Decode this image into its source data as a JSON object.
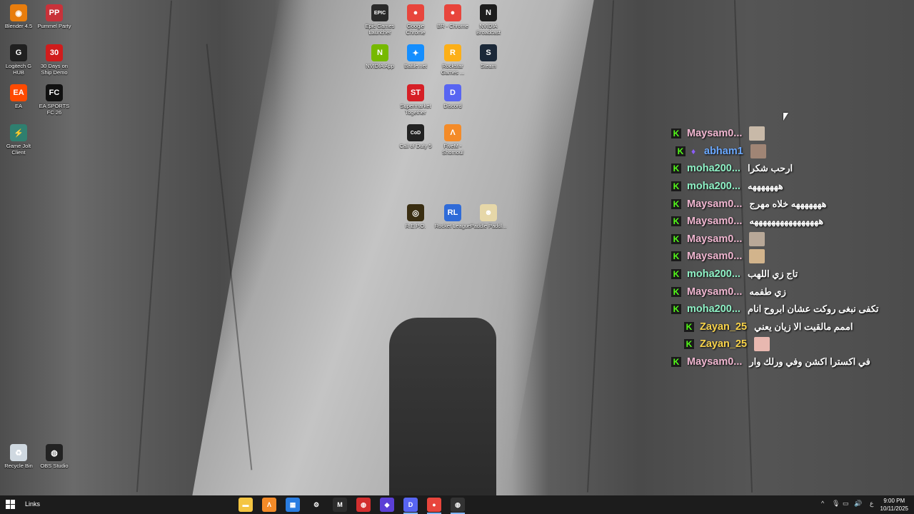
{
  "desktop_icons": [
    {
      "label": "Blender 4.5",
      "icon": "blender-icon",
      "color": "#e87d0d",
      "glyph": "◉"
    },
    {
      "label": "Pummel Party",
      "icon": "pummel-party-icon",
      "color": "#c8323a",
      "glyph": "PP"
    },
    {
      "label": "Logitech G HUB",
      "icon": "logitech-g-icon",
      "color": "#202020",
      "glyph": "G"
    },
    {
      "label": "30 Days on Ship Demo",
      "icon": "30-days-icon",
      "color": "#d01c1c",
      "glyph": "30"
    },
    {
      "label": "EA",
      "icon": "ea-icon",
      "color": "#ff4a00",
      "glyph": "EA"
    },
    {
      "label": "EA SPORTS FC 26",
      "icon": "fc26-icon",
      "color": "#111111",
      "glyph": "FC"
    },
    {
      "label": "Game Jolt Client",
      "icon": "game-jolt-icon",
      "color": "#2f7f6f",
      "glyph": "⚡"
    },
    {
      "label": "Epic Games Launcher",
      "icon": "epic-games-icon",
      "color": "#2a2a2a",
      "glyph": "EPIC"
    },
    {
      "label": "Google Chrome",
      "icon": "chrome-icon",
      "color": "#e8453c",
      "glyph": "●"
    },
    {
      "label": "BR - Chrome",
      "icon": "chrome-profile-icon",
      "color": "#e8453c",
      "glyph": "●"
    },
    {
      "label": "NVIDIA Broadcast",
      "icon": "nvidia-broadcast-icon",
      "color": "#1d1d1d",
      "glyph": "N"
    },
    {
      "label": "NVIDIA App",
      "icon": "nvidia-app-icon",
      "color": "#76b900",
      "glyph": "N"
    },
    {
      "label": "Battle.net",
      "icon": "battlenet-icon",
      "color": "#148eff",
      "glyph": "✦"
    },
    {
      "label": "Rockstar Games ...",
      "icon": "rockstar-icon",
      "color": "#fcaf17",
      "glyph": "R"
    },
    {
      "label": "Steam",
      "icon": "steam-icon",
      "color": "#1b2838",
      "glyph": "S"
    },
    {
      "label": "Supermarket Together",
      "icon": "supermarket-icon",
      "color": "#d61f26",
      "glyph": "ST"
    },
    {
      "label": "Discord",
      "icon": "discord-icon",
      "color": "#5865f2",
      "glyph": "D"
    },
    {
      "label": "Call of Duty 5",
      "icon": "call-of-duty-icon",
      "color": "#222222",
      "glyph": "CoD"
    },
    {
      "label": "FiveM - Shomoul",
      "icon": "fivem-icon",
      "color": "#f48b28",
      "glyph": "Λ"
    },
    {
      "label": "R.E.P.O.",
      "icon": "repo-icon",
      "color": "#3a2e12",
      "glyph": "◎"
    },
    {
      "label": "Rocket League",
      "icon": "rocket-league-icon",
      "color": "#2f6bd8",
      "glyph": "RL"
    },
    {
      "label": "Paddle Paddl...",
      "icon": "paddle-icon",
      "color": "#e6d7a8",
      "glyph": "☻"
    },
    {
      "label": "Recycle Bin",
      "icon": "recycle-bin-icon",
      "color": "#cfd8e0",
      "glyph": "♻"
    },
    {
      "label": "OBS Studio",
      "icon": "obs-icon",
      "color": "#222222",
      "glyph": "◍"
    }
  ],
  "chat": {
    "platform_badge": "K",
    "messages": [
      {
        "user": "Maysam0...",
        "color": "#f0b6d0",
        "text": "",
        "emote": "#c8b9a8",
        "sub": false
      },
      {
        "user": "abham1",
        "color": "#6aa8ff",
        "text": "",
        "emote": "#a08575",
        "sub": true
      },
      {
        "user": "moha200...",
        "color": "#8ff2c6",
        "text": "ارحب شكرا",
        "emote": null,
        "sub": false
      },
      {
        "user": "moha200...",
        "color": "#8ff2c6",
        "text": "هههههههه",
        "emote": null,
        "sub": false
      },
      {
        "user": "Maysam0...",
        "color": "#f0b6d0",
        "text": "هههههههه خلاه مهرج",
        "emote": null,
        "sub": false
      },
      {
        "user": "Maysam0...",
        "color": "#f0b6d0",
        "text": "ههههههههههههههههه",
        "emote": null,
        "sub": false
      },
      {
        "user": "Maysam0...",
        "color": "#f0b6d0",
        "text": "",
        "emote": "#b8a898",
        "sub": false
      },
      {
        "user": "Maysam0...",
        "color": "#f0b6d0",
        "text": "",
        "emote": "#d2b48c",
        "sub": false
      },
      {
        "user": "moha200...",
        "color": "#8ff2c6",
        "text": "تاج زي اللهب",
        "emote": null,
        "sub": false
      },
      {
        "user": "Maysam0...",
        "color": "#f0b6d0",
        "text": "زي طفمه",
        "emote": null,
        "sub": false
      },
      {
        "user": "moha200...",
        "color": "#8ff2c6",
        "text": "تكفى نبغى روكت عشان ابروح انام",
        "emote": null,
        "sub": false
      },
      {
        "user": "Zayan_25",
        "color": "#f7d24a",
        "text": "اممم مالقيت الا زيان يعني",
        "emote": null,
        "sub": false,
        "indent": true
      },
      {
        "user": "Zayan_25",
        "color": "#f7d24a",
        "text": "",
        "emote": "#e8b8b0",
        "sub": false,
        "indent": true
      },
      {
        "user": "Maysam0...",
        "color": "#f0b6d0",
        "text": "في اكسترا اكشن وفي ورلك وار",
        "emote": null,
        "sub": false
      }
    ]
  },
  "taskbar": {
    "links_label": "Links",
    "apps": [
      {
        "name": "file-explorer-icon",
        "color": "#f4c542",
        "glyph": "▬"
      },
      {
        "name": "fivem-taskbar-icon",
        "color": "#f48b28",
        "glyph": "Λ"
      },
      {
        "name": "store-icon",
        "color": "#2a7de1",
        "glyph": "▦"
      },
      {
        "name": "settings-gear-icon",
        "color": "#1c1c1c",
        "glyph": "⚙"
      },
      {
        "name": "mc-app-icon",
        "color": "#2c2c2c",
        "glyph": "M"
      },
      {
        "name": "red-circle-app-icon",
        "color": "#d32f2f",
        "glyph": "◍"
      },
      {
        "name": "purple-app-icon",
        "color": "#5b3fd6",
        "glyph": "◆"
      },
      {
        "name": "discord-taskbar-icon",
        "color": "#5865f2",
        "glyph": "D"
      },
      {
        "name": "chrome-taskbar-icon",
        "color": "#e8453c",
        "glyph": "●"
      },
      {
        "name": "obs-taskbar-icon",
        "color": "#333333",
        "glyph": "◍"
      }
    ],
    "tray": {
      "chevron": "^",
      "lang": "ع",
      "time": "9:00 PM",
      "date": "10/11/2025"
    }
  }
}
